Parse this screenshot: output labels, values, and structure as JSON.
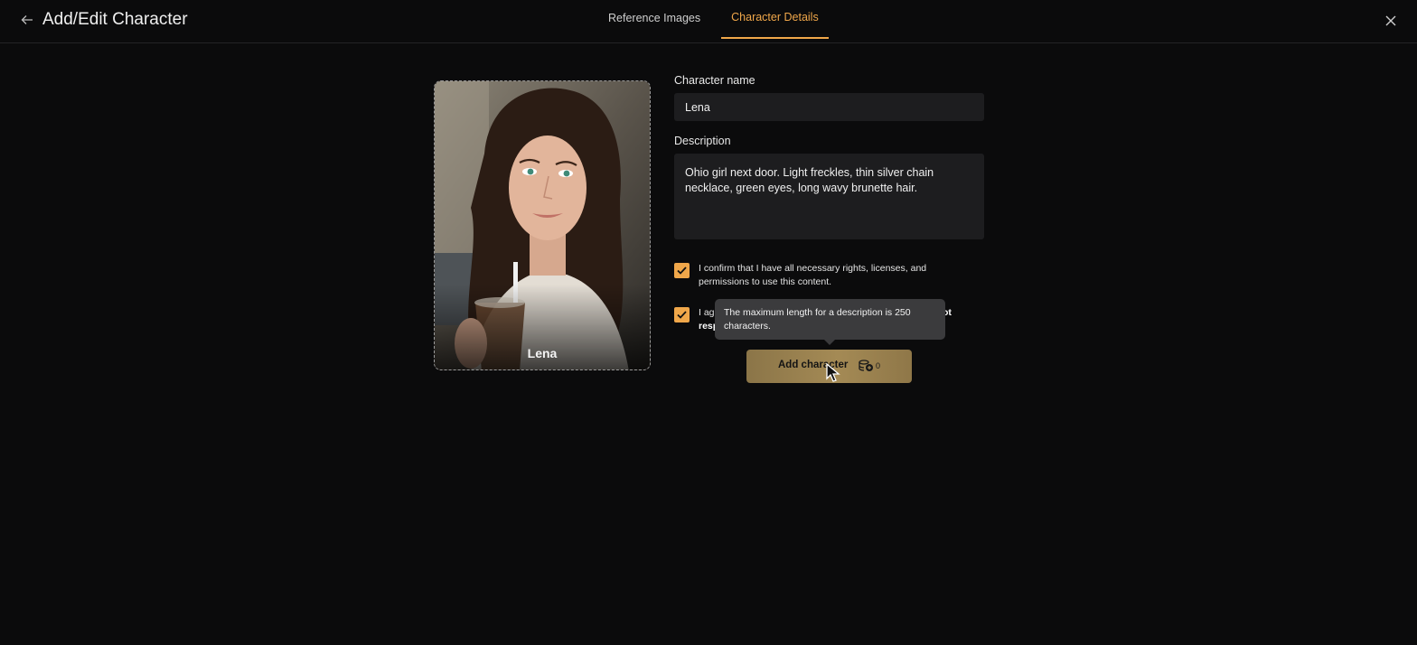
{
  "header": {
    "title": "Add/Edit Character",
    "tabs": [
      {
        "label": "Reference Images",
        "active": false
      },
      {
        "label": "Character Details",
        "active": true
      }
    ]
  },
  "preview": {
    "caption": "Lena"
  },
  "form": {
    "name_label": "Character name",
    "name_value": "Lena",
    "description_label": "Description",
    "description_value": "Ohio girl next door. Light freckles, thin silver chain necklace, green eyes, long wavy brunette hair.",
    "confirm_rights": {
      "checked": true,
      "text": "I confirm that I have all necessary rights, licenses, and permissions to use this content."
    },
    "agree_terms": {
      "checked": true,
      "text_start": "I agu",
      "text_end": "ot",
      "text_bold_line2": "resp"
    }
  },
  "tooltip": {
    "text": "The maximum length for a description is 250 characters."
  },
  "submit": {
    "label": "Add character",
    "credit_count": "0"
  },
  "colors": {
    "accent": "#f0a74a",
    "background": "#0b0b0c",
    "input_bg": "#1d1d1f",
    "button_gold": "#a48a55"
  },
  "icons": [
    "back-arrow-icon",
    "close-icon",
    "check-icon",
    "coins-icon",
    "cursor-icon"
  ]
}
